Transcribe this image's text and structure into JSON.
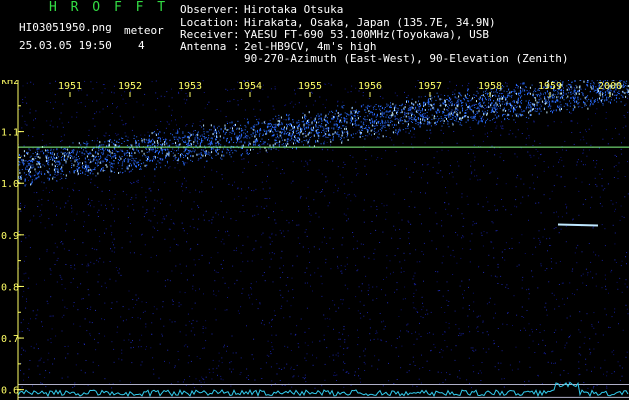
{
  "app": {
    "title": "H R O F F T",
    "filename": "HI03051950.png",
    "datetime": "25.03.05 19:50",
    "meteor_label": "meteor",
    "meteor_count": "4"
  },
  "info": [
    {
      "label": "Observer",
      "value": "Hirotaka Otsuka"
    },
    {
      "label": "Location",
      "value": "Hirakata, Osaka, Japan (135.7E, 34.9N)"
    },
    {
      "label": "Receiver",
      "value": "YAESU FT-690 53.100MHz(Toyokawa), USB"
    },
    {
      "label": "Antenna",
      "value": "2el-HB9CV, 4m's high"
    },
    {
      "label": "",
      "value": "90-270-Azimuth (East-West), 90-Elevation (Zenith)"
    }
  ],
  "separator": ":",
  "colors": {
    "background": "#000000",
    "title": "#33dd44",
    "text": "#ffffff",
    "axis": "#ffff66",
    "carrier": "#88ff88",
    "signal": "#2a6cff",
    "signal_bright": "#bfe8ff"
  },
  "chart_data": {
    "type": "heatmap",
    "ylabel": "kHz",
    "x_tick_labels": [
      "1951",
      "1952",
      "1953",
      "1954",
      "1955",
      "1956",
      "1957",
      "1958",
      "1959",
      "2000"
    ],
    "y_tick_labels": [
      "1.1",
      "1.0",
      "0.9",
      "0.8",
      "0.7",
      "0.6"
    ],
    "ylim": [
      0.58,
      1.2
    ],
    "carrier_khz": 1.07,
    "drift_band": {
      "start_khz": 1.03,
      "end_khz": 1.19
    },
    "meteor_echo": {
      "time": "1959.4",
      "khz": 0.92
    }
  }
}
